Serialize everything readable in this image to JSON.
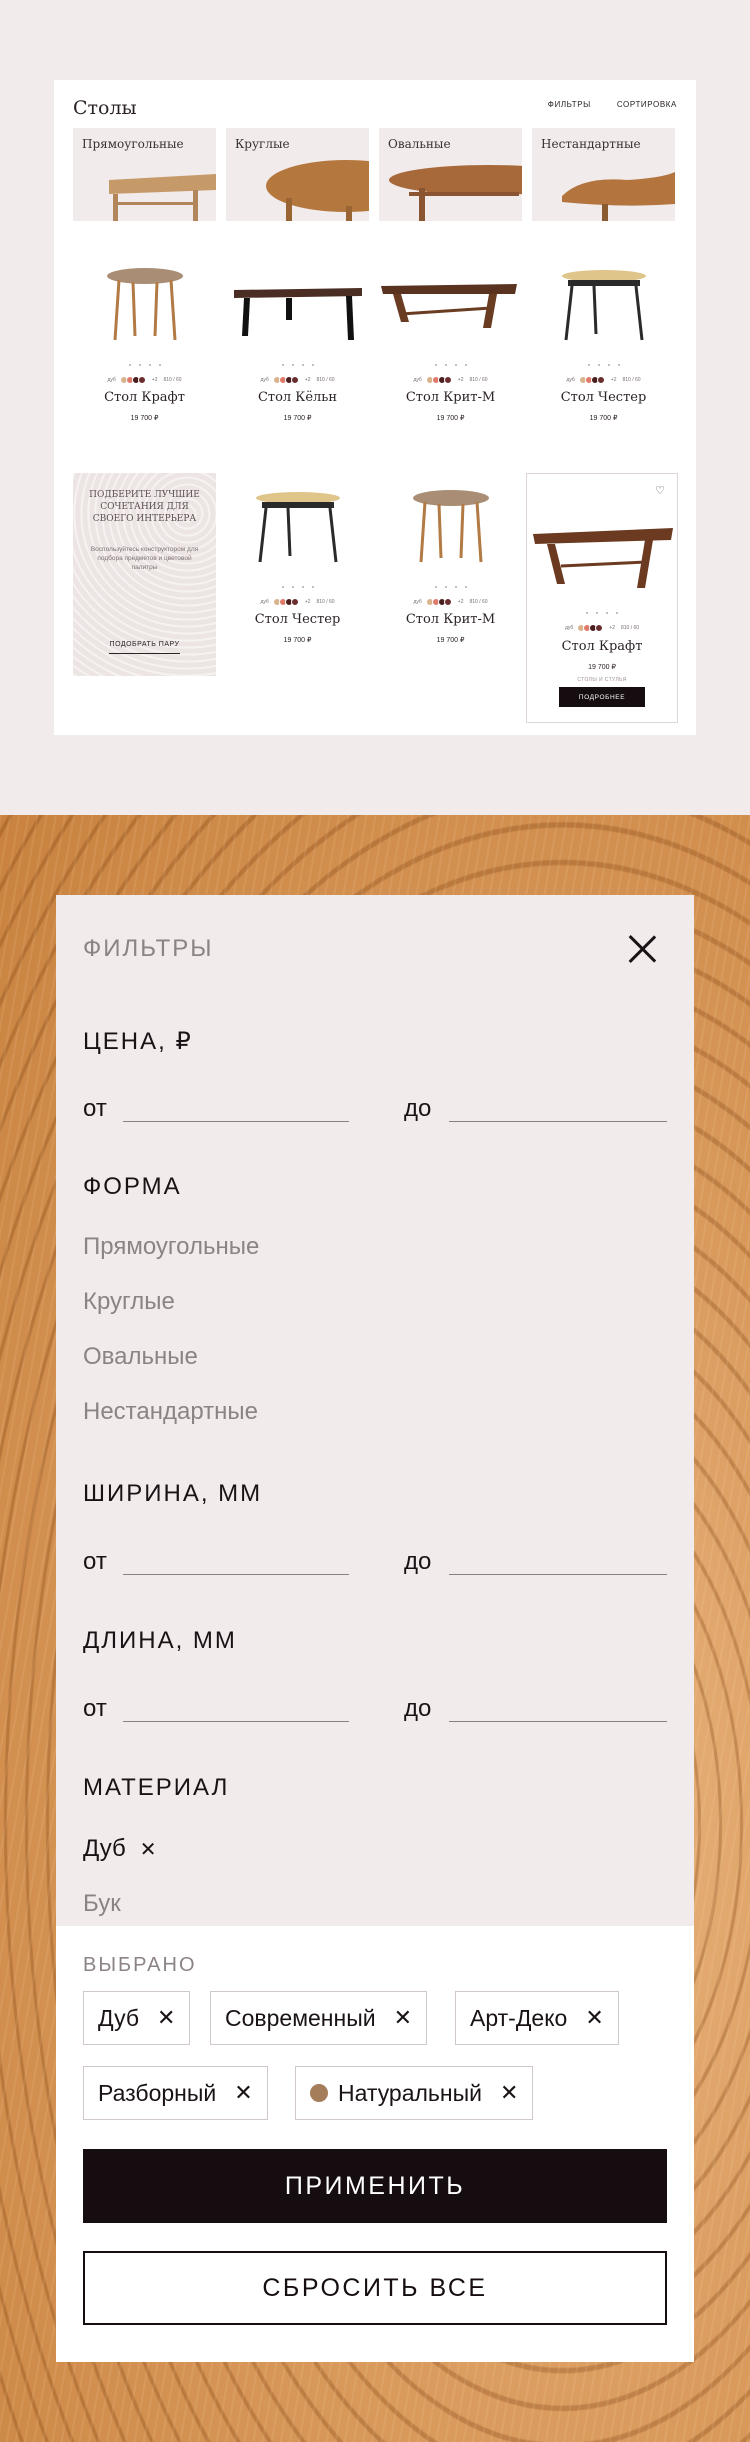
{
  "catalog": {
    "title": "Столы",
    "filters_link": "ФИЛЬТРЫ",
    "sort_link": "СОРТИРОВКА",
    "shapes": [
      "Прямоугольные",
      "Круглые",
      "Овальные",
      "Нестандартные"
    ],
    "meta_material": "дуб",
    "meta_size": "810 / 60",
    "meta_count": "+2",
    "products_row1": [
      {
        "name": "Стол Крафт",
        "price": "19 700 ₽"
      },
      {
        "name": "Стол Кёльн",
        "price": "19 700 ₽"
      },
      {
        "name": "Стол Крит-М",
        "price": "19 700 ₽"
      },
      {
        "name": "Стол Честер",
        "price": "19 700 ₽"
      }
    ],
    "promo": {
      "title": "Подберите лучшие сочетания для своего интерьера",
      "desc": "Воспользуйтесь конструктором для подбора предметов и цветовой палитры",
      "button": "ПОДОБРАТЬ ПАРУ"
    },
    "products_row2": [
      {
        "name": "Стол Честер",
        "price": "19 700 ₽"
      },
      {
        "name": "Стол Крит-М",
        "price": "19 700 ₽"
      },
      {
        "name": "Стол Крафт",
        "price": "19 700 ₽"
      }
    ],
    "featured_sub": "СТОЛЫ И СТУЛЬЯ",
    "featured_button": "ПОДРОБНЕЕ"
  },
  "filter": {
    "title": "ФИЛЬТРЫ",
    "from": "от",
    "to": "до",
    "price_title": "ЦЕНА, ₽",
    "shape_title": "ФОРМА",
    "shapes": [
      "Прямоугольные",
      "Круглые",
      "Овальные",
      "Нестандартные"
    ],
    "width_title": "ШИРИНА, ММ",
    "length_title": "ДЛИНА, ММ",
    "material_title": "МАТЕРИАЛ",
    "materials": [
      {
        "label": "Дуб",
        "selected": true
      },
      {
        "label": "Бук",
        "selected": false
      }
    ],
    "chosen_title": "ВЫБРАНО",
    "chips": [
      {
        "label": "Дуб"
      },
      {
        "label": "Современный"
      },
      {
        "label": "Арт-Деко"
      },
      {
        "label": "Разборный"
      },
      {
        "label": "Натуральный",
        "swatch": "#a47d5a"
      }
    ],
    "apply": "ПРИМЕНИТЬ",
    "reset": "СБРОСИТЬ ВСЕ"
  },
  "colors": {
    "accent": "#150d0f",
    "panel": "#f1ebec"
  }
}
